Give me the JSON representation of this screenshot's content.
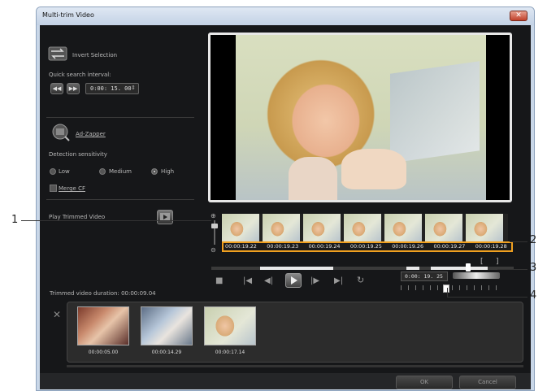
{
  "window": {
    "title": "Multi-trim Video",
    "close_glyph": "✕"
  },
  "left_panel": {
    "invert_selection_label": "Invert Selection",
    "quick_search_label": "Quick search interval:",
    "interval_value": "0:00: 15. 00",
    "ad_zapper_label": "Ad-Zapper",
    "detection_sensitivity_label": "Detection sensitivity",
    "sensitivity_options": [
      "Low",
      "Medium",
      "High"
    ],
    "sensitivity_selected": "High",
    "merge_cf_label": "Merge CF",
    "play_trimmed_label": "Play Trimmed Video"
  },
  "timeline": {
    "timecodes": [
      "00:00:19.22",
      "00:00:19.23",
      "00:00:19.24",
      "00:00:19.25",
      "00:00:19.26",
      "00:00:19.27",
      "00:00:19.28"
    ],
    "mark_in_glyph": "[",
    "mark_out_glyph": "]"
  },
  "playback": {
    "current_time": "0:00: 19. 25",
    "position_fraction": 0.85
  },
  "trimmed": {
    "duration_label": "Trimmed video duration: 00:00:09.04",
    "clips": [
      {
        "timecode": "00:00:05.00"
      },
      {
        "timecode": "00:00:14.29"
      },
      {
        "timecode": "00:00:17.14"
      }
    ],
    "delete_glyph": "✕"
  },
  "dialog_buttons": {
    "ok": "OK",
    "cancel": "Cancel"
  },
  "callouts": [
    "1",
    "2",
    "3",
    "4"
  ],
  "icons": {
    "invert": "invert-selection-icon",
    "rewind": "rewind-icon",
    "forward": "fast-forward-icon",
    "ad_zapper": "ad-zapper-icon",
    "play_trimmed": "play-trimmed-icon",
    "zoom_in": "zoom-in-icon",
    "zoom_out": "zoom-out-icon",
    "stop": "stop-icon",
    "home": "go-to-start-icon",
    "prev": "previous-frame-icon",
    "play": "play-icon",
    "next": "next-frame-icon",
    "end": "go-to-end-icon",
    "repeat": "repeat-icon"
  }
}
